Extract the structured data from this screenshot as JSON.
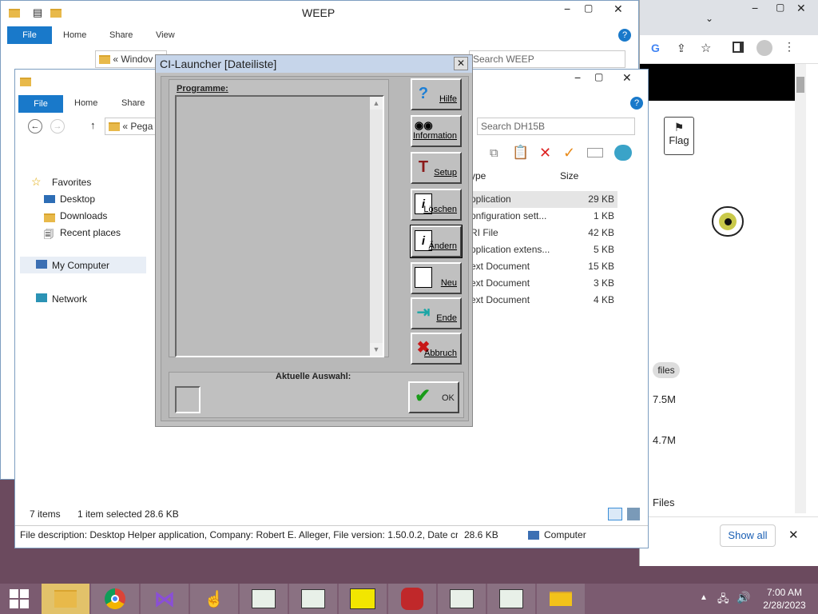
{
  "back_window": {
    "title": "WEEP",
    "tabs": {
      "file": "File",
      "home": "Home",
      "share": "Share",
      "view": "View"
    },
    "address": "Windov",
    "search_placeholder": "Search WEEP"
  },
  "front_window": {
    "tabs": {
      "file": "File",
      "home": "Home",
      "share": "Share"
    },
    "address": "Pega",
    "search_placeholder": "Search DH15B",
    "nav": {
      "favorites": "Favorites",
      "desktop": "Desktop",
      "downloads": "Downloads",
      "recent": "Recent places",
      "mycomputer": "My Computer",
      "network": "Network"
    },
    "columns": {
      "type": "ype",
      "size": "Size"
    },
    "files": [
      {
        "type": "pplication",
        "size": "29 KB"
      },
      {
        "type": "onfiguration sett...",
        "size": "1 KB"
      },
      {
        "type": "RI File",
        "size": "42 KB"
      },
      {
        "type": "pplication extens...",
        "size": "5 KB"
      },
      {
        "type": "ext Document",
        "size": "15 KB"
      },
      {
        "type": "ext Document",
        "size": "3 KB"
      },
      {
        "type": "ext Document",
        "size": "4 KB"
      }
    ],
    "status": {
      "count": "7 items",
      "selected": "1 item selected  28.6 KB"
    },
    "details": {
      "description": "File description: Desktop Helper application, Company: Robert E. Alleger, File version: 1.50.0.2, Date crea",
      "size": "28.6 KB",
      "location": "Computer"
    }
  },
  "ci_launcher": {
    "title": "CI-Launcher  [Dateiliste]",
    "programs_label": "Programme:",
    "selection_label": "Aktuelle Auswahl:",
    "buttons": {
      "help": "Hilfe",
      "info": "Information",
      "setup": "Setup",
      "delete": "Löschen",
      "change": "Ändern",
      "new": "Neu",
      "end": "Ende",
      "cancel": "Abbruch",
      "ok": "OK"
    }
  },
  "browser": {
    "flag_label": "Flag",
    "files_chip": "files",
    "size1": "7.5M",
    "size2": "4.7M",
    "files_label": "Files",
    "show_all": "Show all"
  },
  "taskbar": {
    "time": "7:00 AM",
    "date": "2/28/2023"
  }
}
